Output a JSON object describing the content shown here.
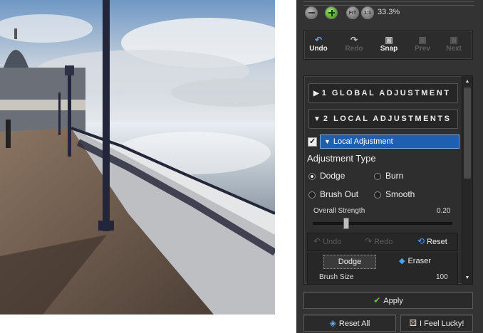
{
  "zoom": {
    "level": "33.3%",
    "buttons": [
      "zoom-out",
      "zoom-in",
      "fit",
      "actual-size"
    ],
    "fit_label": "FIT",
    "actual_label": "1:1"
  },
  "history": {
    "undo": "Undo",
    "redo": "Redo",
    "snap": "Snap",
    "prev": "Prev",
    "next": "Next"
  },
  "sections": {
    "global": "1 GLOBAL ADJUSTMENT",
    "local": "2 LOCAL ADJUSTMENTS"
  },
  "local_adjustment": {
    "enabled": true,
    "title": "Local Adjustment",
    "type_label": "Adjustment Type",
    "types": [
      {
        "label": "Dodge",
        "selected": true
      },
      {
        "label": "Burn",
        "selected": false
      },
      {
        "label": "Brush Out",
        "selected": false
      },
      {
        "label": "Smooth",
        "selected": false
      }
    ],
    "strength_label": "Overall Strength",
    "strength_value": "0.20",
    "strength_fraction": 0.2,
    "undo": "Undo",
    "redo": "Redo",
    "reset": "Reset",
    "brush_modes": {
      "dodge": "Dodge",
      "eraser": "Eraser"
    },
    "brush_size_label": "Brush Size",
    "brush_size_value": "100"
  },
  "actions": {
    "apply": "Apply",
    "reset_all": "Reset All",
    "lucky": "I Feel Lucky!"
  },
  "colors": {
    "panel_bg": "#333333",
    "selection_blue": "#1d5fb0",
    "apply_check": "#5bd23a"
  }
}
